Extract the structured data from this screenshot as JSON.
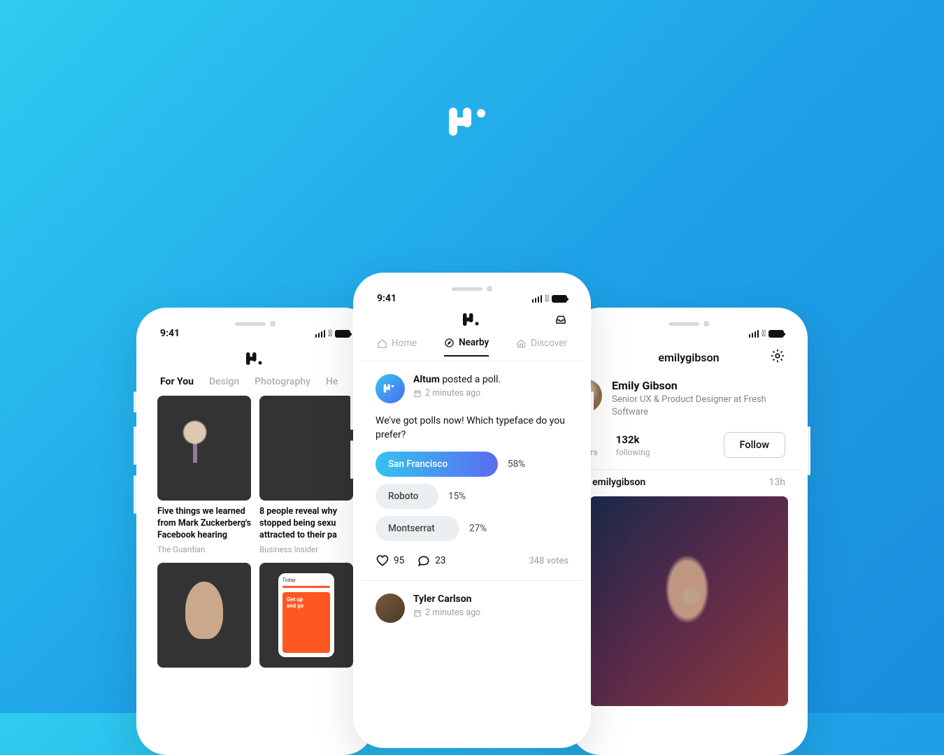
{
  "status": {
    "time": "9:41"
  },
  "phone1": {
    "tabs": [
      "For You",
      "Design",
      "Photography",
      "He"
    ],
    "cards": [
      {
        "title": "Five things we learned from Mark Zuckerberg's Facebook hearing",
        "source": "The Guardian"
      },
      {
        "title": "8 people reveal why stopped being sexu attracted to their pa",
        "source": "Business Insider"
      }
    ],
    "promo": {
      "today": "Today",
      "slogan1": "Get up",
      "slogan2": "and go"
    }
  },
  "phone2": {
    "nav": {
      "home": "Home",
      "nearby": "Nearby",
      "discover": "Discover"
    },
    "poll": {
      "author": "Altum",
      "action": "posted a poll.",
      "time": "2 minutes ago",
      "question": "We've got polls now! Which typeface do you prefer?",
      "options": [
        {
          "label": "San Francisco",
          "pct": "58%"
        },
        {
          "label": "Roboto",
          "pct": "15%"
        },
        {
          "label": "Montserrat",
          "pct": "27%"
        }
      ],
      "likes": "95",
      "comments": "23",
      "votes": "348 votes"
    },
    "post2": {
      "author": "Tyler Carlson",
      "time": "2 minutes ago"
    }
  },
  "phone3": {
    "username": "emilygibson",
    "name": "Emily Gibson",
    "role": "Senior UX & Product Designer at Fresh Software",
    "stats": {
      "following_num": "132k",
      "following_lbl": "following",
      "followers_lbl": "wers"
    },
    "follow": "Follow",
    "post": {
      "who": "emilygibson",
      "when": "13h"
    }
  }
}
